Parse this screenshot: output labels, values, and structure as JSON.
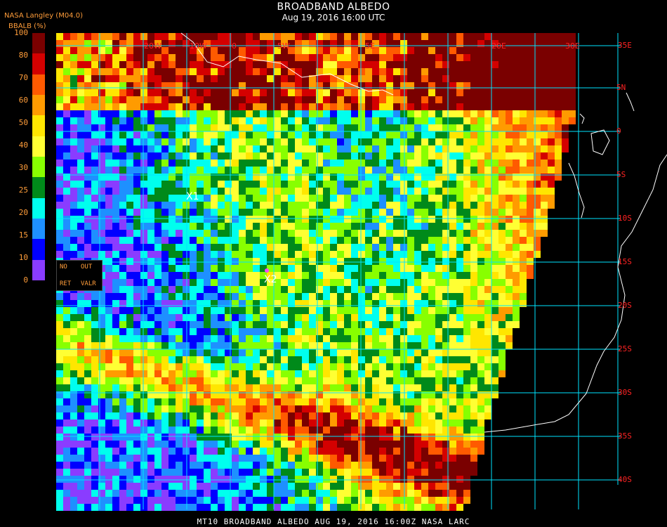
{
  "header": {
    "title": "BROADBAND ALBEDO",
    "subtitle": "Aug 19, 2016 16:00 UTC",
    "source": "NASA Langley (M04.0)",
    "colorbar_label": "BBALB (%)"
  },
  "colorbar": {
    "ticks": [
      "100",
      "80",
      "70",
      "60",
      "50",
      "40",
      "30",
      "25",
      "20",
      "15",
      "10",
      "0"
    ],
    "colors": [
      "#7a0000",
      "#d40000",
      "#ff5a00",
      "#ff9b00",
      "#ffe600",
      "#ffff33",
      "#88ff00",
      "#008a1a",
      "#00ffee",
      "#1e90ff",
      "#0000ff",
      "#8a3cff"
    ]
  },
  "legend": {
    "no": "NO",
    "out": "OUT",
    "ret": "RET",
    "valr": "VALR"
  },
  "markers": [
    {
      "label": "X1"
    },
    {
      "label": "X2"
    }
  ],
  "lat_labels": [
    "35E",
    "5N",
    "0",
    "5S",
    "10S",
    "15S",
    "20S",
    "25S",
    "30S",
    "35S",
    "40S"
  ],
  "top_labels": [
    "20W",
    "10W",
    "0",
    "5W",
    "5E",
    "20E",
    "30E"
  ],
  "footer": "MT10  BROADBAND ALBEDO   AUG 19, 2016 16:00Z   NASA LARC",
  "colors": {
    "grid": "#00e5ff",
    "coast": "#ffffff",
    "tick_text": "#ff9d3a",
    "lat_text": "#ff2222"
  }
}
